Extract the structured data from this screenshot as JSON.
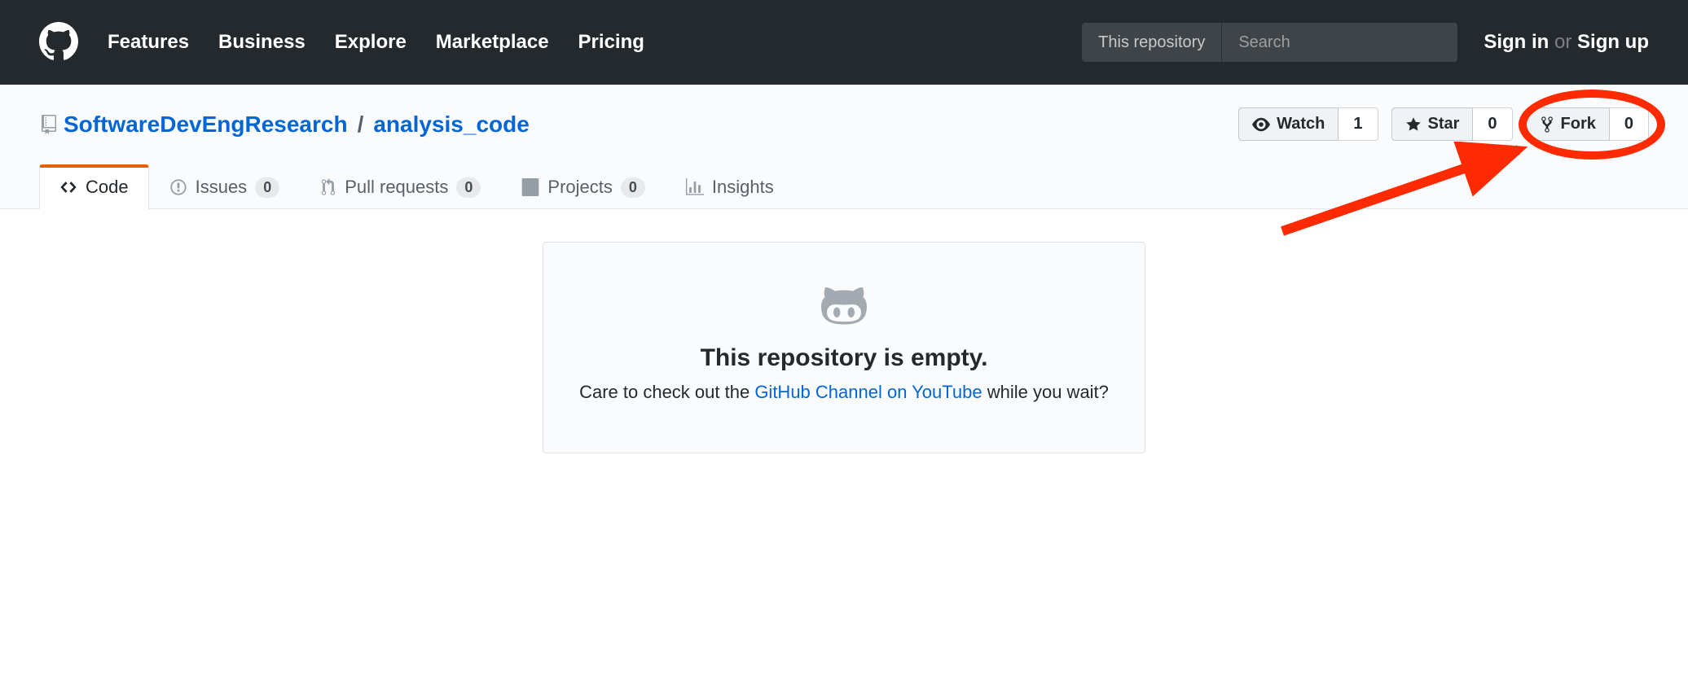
{
  "topnav": {
    "items": [
      "Features",
      "Business",
      "Explore",
      "Marketplace",
      "Pricing"
    ],
    "search_scope": "This repository",
    "search_placeholder": "Search",
    "sign_in": "Sign in",
    "or": "or",
    "sign_up": "Sign up"
  },
  "repo": {
    "owner": "SoftwareDevEngResearch",
    "name": "analysis_code"
  },
  "actions": {
    "watch": {
      "label": "Watch",
      "count": "1"
    },
    "star": {
      "label": "Star",
      "count": "0"
    },
    "fork": {
      "label": "Fork",
      "count": "0"
    }
  },
  "tabs": {
    "code": "Code",
    "issues": {
      "label": "Issues",
      "count": "0"
    },
    "pulls": {
      "label": "Pull requests",
      "count": "0"
    },
    "projects": {
      "label": "Projects",
      "count": "0"
    },
    "insights": "Insights"
  },
  "blank": {
    "heading": "This repository is empty.",
    "pre": "Care to check out the ",
    "link": "GitHub Channel on YouTube",
    "post": " while you wait?"
  }
}
